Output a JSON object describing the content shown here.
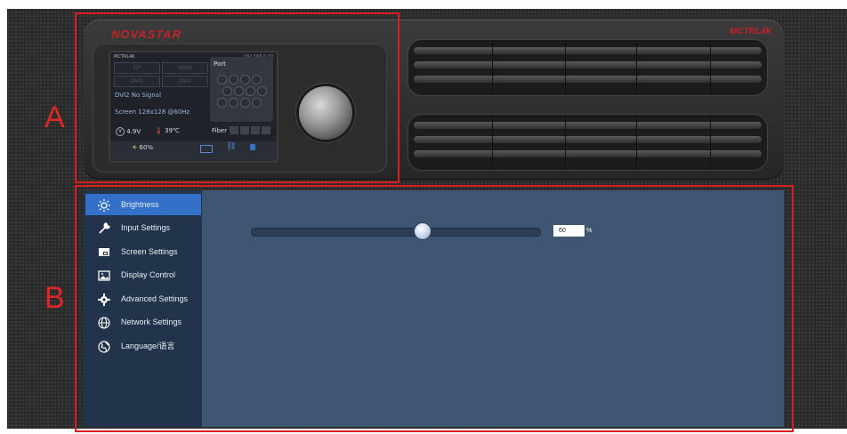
{
  "markers": {
    "a": "A",
    "b": "B"
  },
  "device": {
    "brand": "NOVASTAR",
    "model": "MCTRL4K",
    "lcd": {
      "header": "MCTRL4K",
      "ip": "192.168.0.10",
      "inputs": [
        "DP",
        "HDMI",
        "DVI1",
        "DVI2"
      ],
      "signal_text": "DVI2 No Signal",
      "screen_text": "Screen 128x128 @60Hz",
      "port_label": "Port",
      "voltage": "4.9V",
      "temperature": "39℃",
      "fiber_label": "Fiber",
      "brightness": "60%"
    }
  },
  "sidebar": {
    "items": [
      {
        "label": "Brightness",
        "icon": "brightness-icon",
        "active": true
      },
      {
        "label": "Input Settings",
        "icon": "wrench-icon"
      },
      {
        "label": "Screen Settings",
        "icon": "screen-icon"
      },
      {
        "label": "Display Control",
        "icon": "image-icon"
      },
      {
        "label": "Advanced Settings",
        "icon": "gear-icon"
      },
      {
        "label": "Network Settings",
        "icon": "globe-icon"
      },
      {
        "label": "Language/语言",
        "icon": "language-icon"
      }
    ]
  },
  "brightness": {
    "value": "60",
    "unit": "%",
    "level": 0.6
  },
  "colors": {
    "accent": "#3370c8",
    "panel": "#3e5671",
    "sidebar": "#22344b",
    "marker": "#e02626",
    "brand": "#c0242a"
  }
}
